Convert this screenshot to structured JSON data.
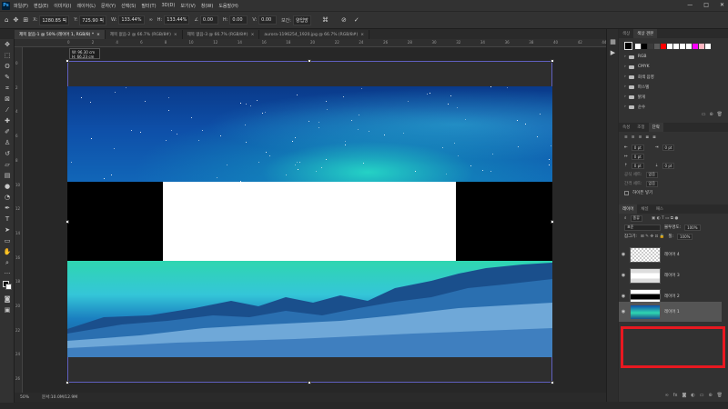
{
  "app": {
    "logo": "Ps",
    "menu": [
      "파일(F)",
      "편집(E)",
      "이미지(I)",
      "레이어(L)",
      "문자(Y)",
      "선택(S)",
      "필터(T)",
      "3D(D)",
      "보기(V)",
      "창(W)",
      "도움말(H)"
    ],
    "window_controls": [
      "—",
      "□",
      "✕"
    ]
  },
  "options": {
    "x": "1280.85 픽",
    "y": "725.90 픽",
    "w": "133.44%",
    "h": "133.44%",
    "angle": "0.00",
    "hskew": "0.00",
    "vskew": "0.00",
    "interp": "양입방"
  },
  "tabs": [
    {
      "label": "제목 없음-1 @ 50% (레이어 1, RGB/8) *",
      "active": true
    },
    {
      "label": "제목 없음-2 @ 66.7% (RGB/8#)",
      "active": false
    },
    {
      "label": "제목 없음-3 @ 66.7% (RGB/8#)",
      "active": false
    },
    {
      "label": "aurora-1196254_1920.jpg @ 66.7% (RGB/8#)",
      "active": false
    }
  ],
  "ruler": {
    "top": [
      "0",
      "2",
      "4",
      "6",
      "8",
      "10",
      "12",
      "14",
      "16",
      "18",
      "20",
      "22",
      "24",
      "26",
      "28",
      "30",
      "32",
      "34",
      "36",
      "38",
      "40",
      "42",
      "44",
      "46"
    ],
    "left": [
      "0",
      "2",
      "4",
      "6",
      "8",
      "10",
      "12",
      "14",
      "16",
      "18",
      "20",
      "22",
      "24",
      "26"
    ]
  },
  "tooltip": {
    "w": "W: 96.30 cm",
    "h": "H: 66.23 cm"
  },
  "status": {
    "zoom": "50%",
    "doc": "문서:10.0M/12.9M"
  },
  "swatches": {
    "tabs": [
      "색상",
      "색상 견본"
    ],
    "colors": [
      "#ffffff",
      "#000000",
      "#3a3a3a",
      "#5a5a5a",
      "#ff0000",
      "#ffffff",
      "#ffffff",
      "#ffffff",
      "#ffffff",
      "#ff00ff",
      "#ffb6c1",
      "#ffffff"
    ],
    "groups": [
      "RGB",
      "CMYK",
      "회색 음영",
      "파스텔",
      "밝게",
      "순수"
    ]
  },
  "props": {
    "tabs": [
      "속성",
      "조정",
      "단락"
    ],
    "fields": [
      "0 pt",
      "0 pt",
      "0 pt",
      "0 pt",
      "0 pt"
    ],
    "extra": [
      "공식 세트:",
      "간격 세트:"
    ],
    "extra_values": [
      "없음",
      "없음"
    ],
    "hyphen": "하이픈 넣기"
  },
  "layers_panel": {
    "tabs": [
      "레이어",
      "채널",
      "패스"
    ],
    "kind": "종류",
    "blend": "표준",
    "opacity_label": "불투명도:",
    "opacity": "100%",
    "lock_label": "잠그기:",
    "fill_label": "칠:",
    "fill": "100%",
    "layers": [
      {
        "name": "레이어 4",
        "selected": false
      },
      {
        "name": "레이어 3",
        "selected": false
      },
      {
        "name": "레이어 2",
        "selected": false
      },
      {
        "name": "레이어 1",
        "selected": true
      }
    ]
  },
  "colors": {
    "highlight": "#e81820",
    "selection_bounds": "#6060c0"
  }
}
